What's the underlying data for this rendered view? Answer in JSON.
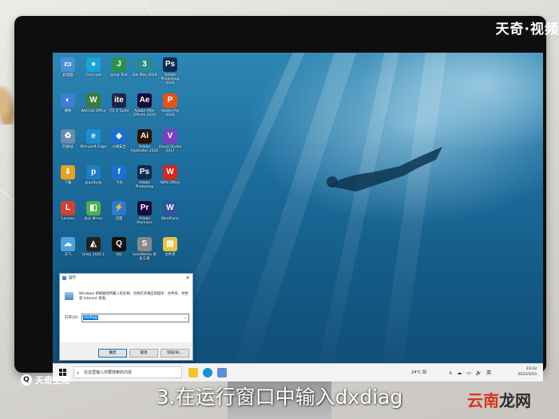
{
  "overlay": {
    "brand_top": "天奇·视频",
    "brand_bottom": "天奇生活",
    "caption": "3.在运行窗口中输入dxdiag",
    "watermark_a": "云南",
    "watermark_b": "龙网"
  },
  "desktop_icons": [
    {
      "label": "此电脑",
      "glyph": "▭",
      "color": "#4a90d9"
    },
    {
      "label": "Cisco Jab",
      "glyph": "●",
      "color": "#1aa3d9"
    },
    {
      "label": "Jump Test",
      "glyph": "J",
      "color": "#2d8f4e"
    },
    {
      "label": "3ds Max 2020",
      "glyph": "3",
      "color": "#2b8a8a"
    },
    {
      "label": "Adobe Photoshop 2020",
      "glyph": "Ps",
      "color": "#0c2c4e"
    },
    {
      "label": "网络",
      "glyph": "◐",
      "color": "#3d7ed6"
    },
    {
      "label": "WeChat Office",
      "glyph": "W",
      "color": "#3c7c3c"
    },
    {
      "label": "ITE IT Suite",
      "glyph": "ite",
      "color": "#224"
    },
    {
      "label": "Adobe After Effects 2020",
      "glyph": "Ae",
      "color": "#1a0a3a"
    },
    {
      "label": "Adobe Pro 2020",
      "glyph": "P",
      "color": "#e0541a"
    },
    {
      "label": "回收站",
      "glyph": "♻",
      "color": "#6a8ab0"
    },
    {
      "label": "Microsoft Edge",
      "glyph": "e",
      "color": "#1a8fd0"
    },
    {
      "label": "火绒安全",
      "glyph": "◆",
      "color": "#1a6fd0"
    },
    {
      "label": "Adobe Illustrator 2020",
      "glyph": "Ai",
      "color": "#2a1200"
    },
    {
      "label": "Visual Studio 2017",
      "glyph": "V",
      "color": "#7b3fc4"
    },
    {
      "label": "下载",
      "glyph": "⬇",
      "color": "#e8a020"
    },
    {
      "label": "phpStudy",
      "glyph": "p",
      "color": "#1c7ec2"
    },
    {
      "label": "飞书",
      "glyph": "f",
      "color": "#1a6fd0"
    },
    {
      "label": "Adobe Photoshop",
      "glyph": "Ps",
      "color": "#0c2c4e"
    },
    {
      "label": "WPS Office",
      "glyph": "W",
      "color": "#d4271e"
    },
    {
      "label": "Lenovo",
      "glyph": "L",
      "color": "#c43"
    },
    {
      "label": "办公 Mirror",
      "glyph": "◧",
      "color": "#4caf50"
    },
    {
      "label": "迅雷",
      "glyph": "⚡",
      "color": "#2a7ad2"
    },
    {
      "label": "Adobe Premiere",
      "glyph": "Pr",
      "color": "#1a0a3a"
    },
    {
      "label": "WordForm",
      "glyph": "W",
      "color": "#2b579a"
    },
    {
      "label": "天气",
      "glyph": "☁",
      "color": "#4aa3df"
    },
    {
      "label": "Unity 2020.1",
      "glyph": "◭",
      "color": "#222"
    },
    {
      "label": "QQ",
      "glyph": "Q",
      "color": "#111"
    },
    {
      "label": "SolidWorks 优化工具",
      "glyph": "S",
      "color": "#888"
    },
    {
      "label": "文件夹",
      "glyph": "▤",
      "color": "#e8c34a"
    }
  ],
  "run_dialog": {
    "title": "运行",
    "close": "×",
    "prompt": "Windows 将根据你所输入的名称，为你打开相应的程序、文件夹、文档或 Internet 资源。",
    "open_label": "打开(O):",
    "input_value": "dxdiag",
    "ok": "确定",
    "cancel": "取消",
    "browse": "浏览(B)..."
  },
  "taskbar": {
    "search_placeholder": "在这里输入你要搜索的内容",
    "weather": "24°C 阴",
    "tray": "∧ ☁ ▭ 🔊 英",
    "time": "23:43",
    "date": "2022/3/10"
  }
}
